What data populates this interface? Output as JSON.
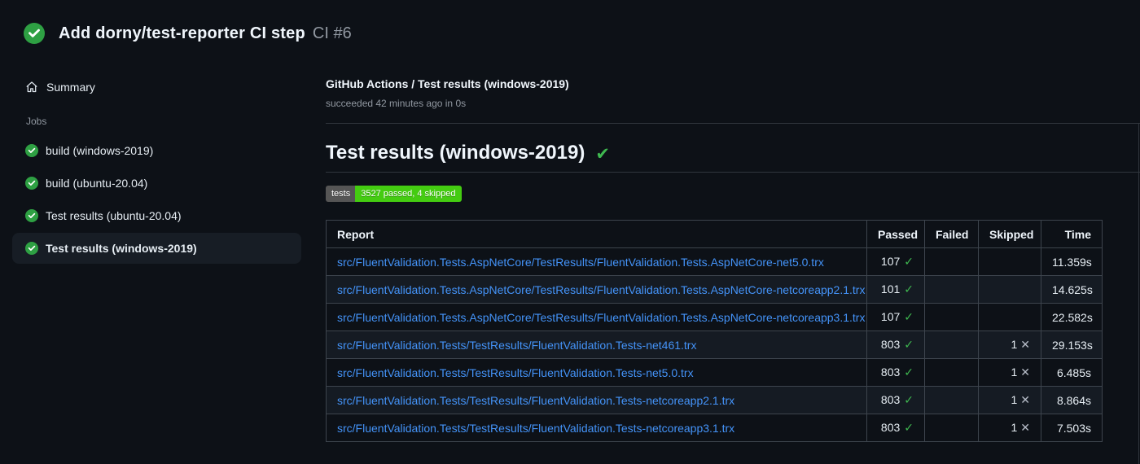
{
  "header": {
    "title": "Add dorny/test-reporter CI step",
    "run_number": "CI #6"
  },
  "sidebar": {
    "summary_label": "Summary",
    "jobs_label": "Jobs",
    "jobs": [
      {
        "label": "build (windows-2019)",
        "status": "success",
        "selected": false
      },
      {
        "label": "build (ubuntu-20.04)",
        "status": "success",
        "selected": false
      },
      {
        "label": "Test results (ubuntu-20.04)",
        "status": "success",
        "selected": false
      },
      {
        "label": "Test results (windows-2019)",
        "status": "success",
        "selected": true
      }
    ]
  },
  "main": {
    "check_name": "GitHub Actions / Test results (windows-2019)",
    "check_status": "succeeded 42 minutes ago in 0s",
    "section_title": "Test results (windows-2019)",
    "section_status_icon": "✔",
    "badge": {
      "label": "tests",
      "message": "3527 passed, 4 skipped",
      "label_bg": "#555555",
      "message_bg": "#44cc11"
    },
    "table": {
      "columns": [
        "Report",
        "Passed",
        "Failed",
        "Skipped",
        "Time"
      ],
      "rows": [
        {
          "report": "src/FluentValidation.Tests.AspNetCore/TestResults/FluentValidation.Tests.AspNetCore-net5.0.trx",
          "passed": "107",
          "failed": "",
          "skipped": "",
          "time": "11.359s"
        },
        {
          "report": "src/FluentValidation.Tests.AspNetCore/TestResults/FluentValidation.Tests.AspNetCore-netcoreapp2.1.trx",
          "passed": "101",
          "failed": "",
          "skipped": "",
          "time": "14.625s"
        },
        {
          "report": "src/FluentValidation.Tests.AspNetCore/TestResults/FluentValidation.Tests.AspNetCore-netcoreapp3.1.trx",
          "passed": "107",
          "failed": "",
          "skipped": "",
          "time": "22.582s"
        },
        {
          "report": "src/FluentValidation.Tests/TestResults/FluentValidation.Tests-net461.trx",
          "passed": "803",
          "failed": "",
          "skipped": "1",
          "time": "29.153s"
        },
        {
          "report": "src/FluentValidation.Tests/TestResults/FluentValidation.Tests-net5.0.trx",
          "passed": "803",
          "failed": "",
          "skipped": "1",
          "time": "6.485s"
        },
        {
          "report": "src/FluentValidation.Tests/TestResults/FluentValidation.Tests-netcoreapp2.1.trx",
          "passed": "803",
          "failed": "",
          "skipped": "1",
          "time": "8.864s"
        },
        {
          "report": "src/FluentValidation.Tests/TestResults/FluentValidation.Tests-netcoreapp3.1.trx",
          "passed": "803",
          "failed": "",
          "skipped": "1",
          "time": "7.503s"
        }
      ]
    }
  },
  "colors": {
    "background": "#0d1117",
    "row_alt": "#151b23",
    "border": "#3d444d",
    "text_primary": "#f0f6fc",
    "text_muted": "#9198a1",
    "link": "#4493f8",
    "success_circle": "#2ea043",
    "success_check": "#3fb950",
    "badge_label_bg": "#555555",
    "badge_message_bg": "#44cc11"
  }
}
